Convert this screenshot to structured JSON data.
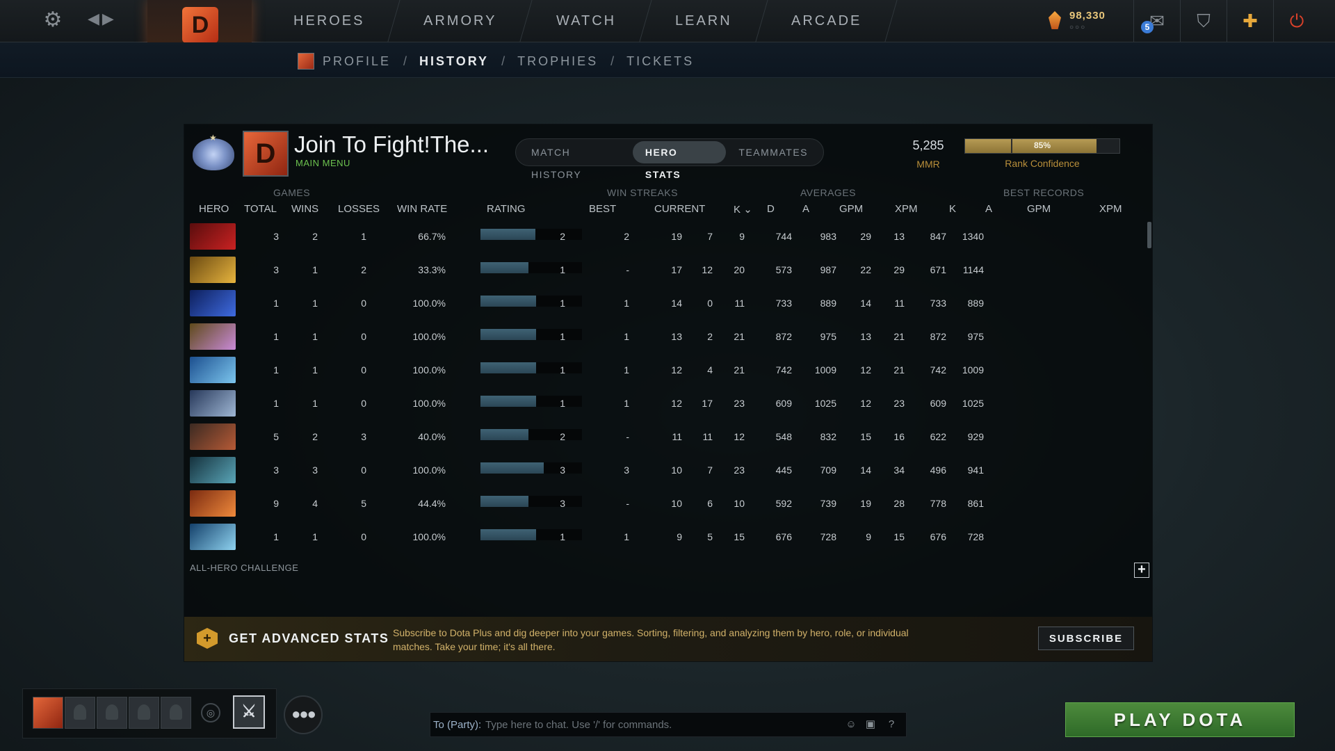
{
  "topbar": {
    "nav": [
      "HEROES",
      "ARMORY",
      "WATCH",
      "LEARN",
      "ARCADE"
    ],
    "shards": "98,330",
    "shard_dots": "○○○",
    "mail_count": "5"
  },
  "subnav": {
    "links": [
      "PROFILE",
      "HISTORY",
      "TROPHIES",
      "TICKETS"
    ],
    "separator": "/",
    "active": "HISTORY"
  },
  "profile": {
    "name": "Join To Fight!The...",
    "status": "MAIN MENU",
    "tabs": [
      "MATCH HISTORY",
      "HERO STATS",
      "TEAMMATES"
    ],
    "active_tab": "HERO STATS",
    "mmr_value": "5,285",
    "mmr_label": "MMR",
    "confidence_percent": "85%",
    "confidence_fraction": 0.85,
    "confidence_label": "Rank Confidence"
  },
  "table": {
    "groups": {
      "games": "GAMES",
      "win_streaks": "WIN STREAKS",
      "averages": "AVERAGES",
      "best_records": "BEST RECORDS"
    },
    "headers": {
      "hero": "HERO",
      "total": "TOTAL",
      "wins": "WINS",
      "losses": "LOSSES",
      "win_rate": "WIN RATE",
      "rating": "RATING",
      "best": "BEST",
      "current": "CURRENT",
      "avg_k": "K",
      "avg_d": "D",
      "avg_a": "A",
      "avg_gpm": "GPM",
      "avg_xpm": "XPM",
      "best_k": "K",
      "best_a": "A",
      "best_gpm": "GPM",
      "best_xpm": "XPM"
    },
    "rows": [
      {
        "hero_colors": [
          "#5a0d0d",
          "#c92222"
        ],
        "total": "3",
        "wins": "2",
        "losses": "1",
        "win_rate": "66.7%",
        "rating": 0.54,
        "best": "2",
        "current": "2",
        "k": "19",
        "d": "7",
        "a": "9",
        "gpm": "744",
        "xpm": "983",
        "bk": "29",
        "ba": "13",
        "bgpm": "847",
        "bxpm": "1340"
      },
      {
        "hero_colors": [
          "#6b4a12",
          "#e7b43e"
        ],
        "total": "3",
        "wins": "1",
        "losses": "2",
        "win_rate": "33.3%",
        "rating": 0.47,
        "best": "1",
        "current": "-",
        "k": "17",
        "d": "12",
        "a": "20",
        "gpm": "573",
        "xpm": "987",
        "bk": "22",
        "ba": "29",
        "bgpm": "671",
        "bxpm": "1144"
      },
      {
        "hero_colors": [
          "#0d1f5c",
          "#3f6be0"
        ],
        "total": "1",
        "wins": "1",
        "losses": "0",
        "win_rate": "100.0%",
        "rating": 0.55,
        "best": "1",
        "current": "1",
        "k": "14",
        "d": "0",
        "a": "11",
        "gpm": "733",
        "xpm": "889",
        "bk": "14",
        "ba": "11",
        "bgpm": "733",
        "bxpm": "889"
      },
      {
        "hero_colors": [
          "#5e4a1a",
          "#c98ad8"
        ],
        "total": "1",
        "wins": "1",
        "losses": "0",
        "win_rate": "100.0%",
        "rating": 0.55,
        "best": "1",
        "current": "1",
        "k": "13",
        "d": "2",
        "a": "21",
        "gpm": "872",
        "xpm": "975",
        "bk": "13",
        "ba": "21",
        "bgpm": "872",
        "bxpm": "975"
      },
      {
        "hero_colors": [
          "#1c4f8f",
          "#7cc6ee"
        ],
        "total": "1",
        "wins": "1",
        "losses": "0",
        "win_rate": "100.0%",
        "rating": 0.55,
        "best": "1",
        "current": "1",
        "k": "12",
        "d": "4",
        "a": "21",
        "gpm": "742",
        "xpm": "1009",
        "bk": "12",
        "ba": "21",
        "bgpm": "742",
        "bxpm": "1009"
      },
      {
        "hero_colors": [
          "#27385a",
          "#9fb7d4"
        ],
        "total": "1",
        "wins": "1",
        "losses": "0",
        "win_rate": "100.0%",
        "rating": 0.55,
        "best": "1",
        "current": "1",
        "k": "12",
        "d": "17",
        "a": "23",
        "gpm": "609",
        "xpm": "1025",
        "bk": "12",
        "ba": "23",
        "bgpm": "609",
        "bxpm": "1025"
      },
      {
        "hero_colors": [
          "#3b2a22",
          "#b65a36"
        ],
        "total": "5",
        "wins": "2",
        "losses": "3",
        "win_rate": "40.0%",
        "rating": 0.47,
        "best": "2",
        "current": "-",
        "k": "11",
        "d": "11",
        "a": "12",
        "gpm": "548",
        "xpm": "832",
        "bk": "15",
        "ba": "16",
        "bgpm": "622",
        "bxpm": "929"
      },
      {
        "hero_colors": [
          "#15313d",
          "#5aa6b8"
        ],
        "total": "3",
        "wins": "3",
        "losses": "0",
        "win_rate": "100.0%",
        "rating": 0.62,
        "best": "3",
        "current": "3",
        "k": "10",
        "d": "7",
        "a": "23",
        "gpm": "445",
        "xpm": "709",
        "bk": "14",
        "ba": "34",
        "bgpm": "496",
        "bxpm": "941"
      },
      {
        "hero_colors": [
          "#7a2a10",
          "#f08a3c"
        ],
        "total": "9",
        "wins": "4",
        "losses": "5",
        "win_rate": "44.4%",
        "rating": 0.47,
        "best": "3",
        "current": "-",
        "k": "10",
        "d": "6",
        "a": "10",
        "gpm": "592",
        "xpm": "739",
        "bk": "19",
        "ba": "28",
        "bgpm": "778",
        "bxpm": "861"
      },
      {
        "hero_colors": [
          "#14406a",
          "#8fd3f0"
        ],
        "total": "1",
        "wins": "1",
        "losses": "0",
        "win_rate": "100.0%",
        "rating": 0.55,
        "best": "1",
        "current": "1",
        "k": "9",
        "d": "5",
        "a": "15",
        "gpm": "676",
        "xpm": "728",
        "bk": "9",
        "ba": "15",
        "bgpm": "676",
        "bxpm": "728"
      }
    ],
    "challenge": "ALL-HERO CHALLENGE"
  },
  "promo": {
    "title": "GET ADVANCED STATS",
    "description": "Subscribe to Dota Plus and dig deeper into your games. Sorting, filtering, and analyzing them by hero, role, or individual matches. Take your time; it's all there.",
    "subscribe": "SUBSCRIBE"
  },
  "chat": {
    "target": "To (Party):",
    "placeholder": "Type here to chat. Use '/' for commands."
  },
  "play_button": "PLAY DOTA",
  "icons": {
    "settings": "gear-icon",
    "currency": "shard-icon",
    "mail": "mail-icon",
    "armory": "armory-icon",
    "plus": "dota-plus-icon",
    "power": "power-icon"
  }
}
